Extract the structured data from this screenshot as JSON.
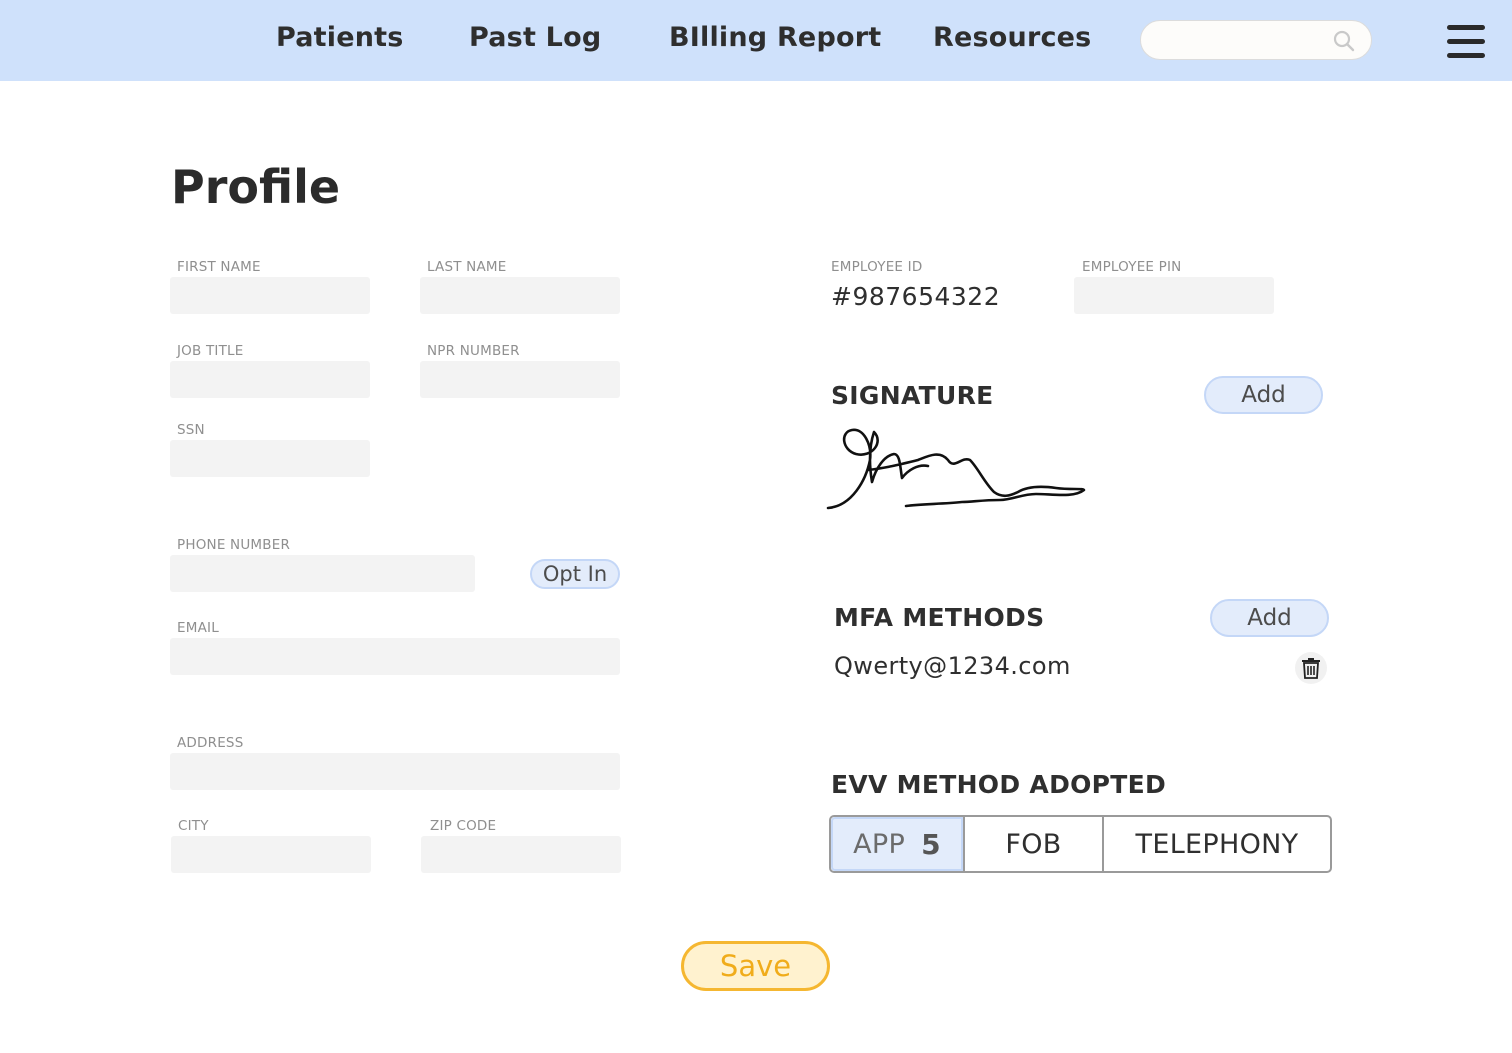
{
  "nav": {
    "links": [
      "Patients",
      "Past Log",
      "BIlling Report",
      "Resources"
    ],
    "search": {
      "value": "",
      "placeholder": ""
    },
    "search_icon": "search-icon",
    "menu_icon": "hamburger-menu-icon",
    "background": "#cfe1fb"
  },
  "profile": {
    "title": "Profile",
    "fields": {
      "first_name": {
        "label": "FIRST NAME",
        "value": ""
      },
      "last_name": {
        "label": "LAST NAME",
        "value": ""
      },
      "job_title": {
        "label": "JOB TITLE",
        "value": ""
      },
      "npr_number": {
        "label": "NPR NUMBER",
        "value": ""
      },
      "ssn": {
        "label": "SSN",
        "value": ""
      },
      "phone_number": {
        "label": "PHONE NUMBER",
        "value": ""
      },
      "email": {
        "label": "EMAIL",
        "value": ""
      },
      "address": {
        "label": "ADDRESS",
        "value": ""
      },
      "city": {
        "label": "CITY",
        "value": ""
      },
      "zip_code": {
        "label": "ZIP CODE",
        "value": ""
      }
    },
    "opt_in_label": "Opt In"
  },
  "employee": {
    "id_label": "EMPLOYEE ID",
    "id_value": "#987654322",
    "pin_label": "EMPLOYEE PIN",
    "pin_value": ""
  },
  "signature": {
    "title": "SIGNATURE",
    "add_label": "Add"
  },
  "mfa": {
    "title": "MFA METHODS",
    "add_label": "Add",
    "email": "Qwerty@1234.com",
    "delete_icon": "trash-icon"
  },
  "evv": {
    "title": "EVV METHOD ADOPTED",
    "options": [
      "APP",
      "FOB",
      "TELEPHONY"
    ],
    "app_badge": "5",
    "selected": "APP"
  },
  "save_label": "Save",
  "colors": {
    "accent_blue": "#c4d7f7",
    "save_border": "#f5b731",
    "save_text": "#f0ac1b"
  }
}
